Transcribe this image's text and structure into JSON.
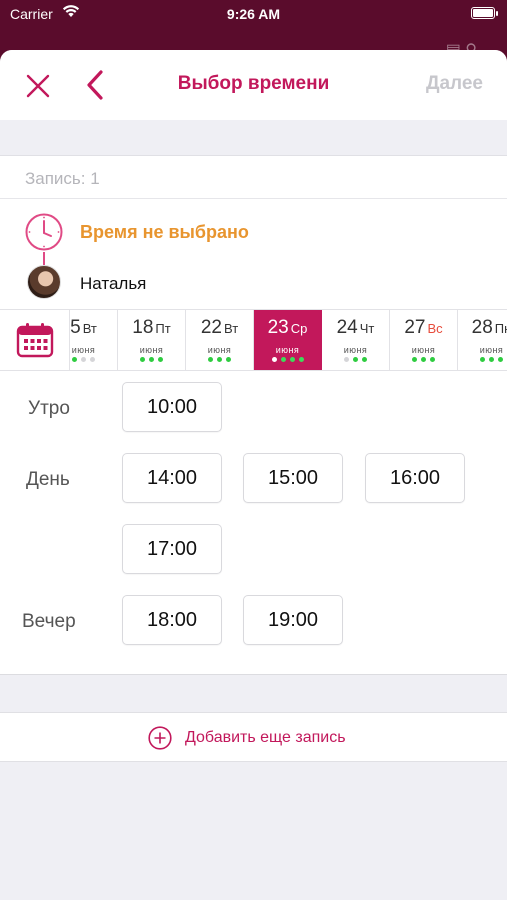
{
  "status_bar": {
    "carrier": "Carrier",
    "time": "9:26 AM"
  },
  "nav": {
    "title": "Выбор времени",
    "next_label": "Далее"
  },
  "record": {
    "label": "Запись: 1"
  },
  "info": {
    "time_status": "Время не выбрано",
    "master_name": "Наталья"
  },
  "colors": {
    "accent": "#c2185b",
    "warning": "#e8952f",
    "available": "#2ecc40"
  },
  "dates": [
    {
      "day": "5",
      "dow": "Вт",
      "month": "июня",
      "dots": [
        "on",
        "off",
        "off"
      ],
      "weekend": false,
      "selected": false
    },
    {
      "day": "18",
      "dow": "Пт",
      "month": "июня",
      "dots": [
        "on",
        "on",
        "on"
      ],
      "weekend": false,
      "selected": false
    },
    {
      "day": "22",
      "dow": "Вт",
      "month": "июня",
      "dots": [
        "on",
        "on",
        "on"
      ],
      "weekend": false,
      "selected": false
    },
    {
      "day": "23",
      "dow": "Ср",
      "month": "июня",
      "dots": [
        "sel",
        "on",
        "on",
        "on"
      ],
      "weekend": false,
      "selected": true
    },
    {
      "day": "24",
      "dow": "Чт",
      "month": "июня",
      "dots": [
        "off",
        "on",
        "on"
      ],
      "weekend": false,
      "selected": false
    },
    {
      "day": "27",
      "dow": "Вс",
      "month": "июня",
      "dots": [
        "on",
        "on",
        "on"
      ],
      "weekend": true,
      "selected": false
    },
    {
      "day": "28",
      "dow": "Пн",
      "month": "июня",
      "dots": [
        "on",
        "on",
        "on"
      ],
      "weekend": false,
      "selected": false
    }
  ],
  "periods": {
    "morning": {
      "label": "Утро",
      "slots": [
        "10:00"
      ]
    },
    "day": {
      "label": "День",
      "slots": [
        "14:00",
        "15:00",
        "16:00",
        "17:00"
      ]
    },
    "evening": {
      "label": "Вечер",
      "slots": [
        "18:00",
        "19:00"
      ]
    }
  },
  "add_record": {
    "label": "Добавить еще запись"
  }
}
